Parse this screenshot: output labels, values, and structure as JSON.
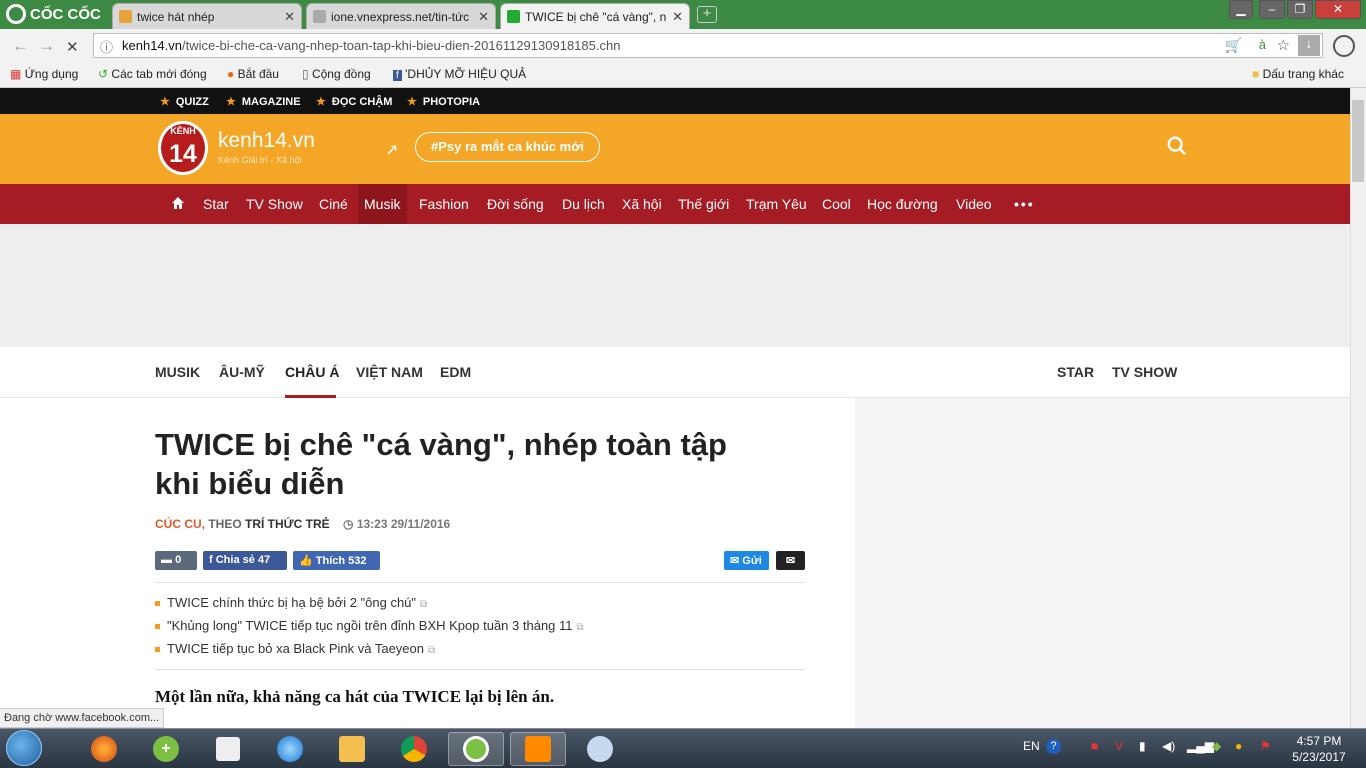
{
  "browser": {
    "logo": "CỐC CỐC",
    "tabs": [
      {
        "label": "twice hát nhép",
        "fav": "#e8a33c"
      },
      {
        "label": "ione.vnexpress.net/tin-tức",
        "fav": "#aaaaaa"
      },
      {
        "label": "TWICE bị chê \"cá vàng\", n",
        "fav": "#22aa33"
      }
    ],
    "url_domain": "kenh14.vn",
    "url_path": "/twice-bi-che-ca-vang-nhep-toan-tap-khi-bieu-dien-20161129130918185.chn"
  },
  "bookmarks": [
    "Ứng dụng",
    "Các tab mới đóng",
    "Bắt đầu",
    "Cộng đồng",
    "'DHỦY MỠ HIỆU QUẢ",
    "Dấu trang khác"
  ],
  "topstrip": [
    "QUIZZ",
    "MAGAZINE",
    "ĐỌC CHẬM",
    "PHOTOPIA"
  ],
  "header": {
    "badge_top": "KÊNH",
    "badge_num": "14",
    "site": "kenh14.vn",
    "tagline": "Kênh Giải trí - Xã hội",
    "trending": "#Psy ra mắt ca khúc mới"
  },
  "mainnav": [
    "Star",
    "TV Show",
    "Ciné",
    "Musik",
    "Fashion",
    "Đời sống",
    "Du lịch",
    "Xã hội",
    "Thế giới",
    "Trạm Yêu",
    "Cool",
    "Học đường",
    "Video"
  ],
  "subnav": {
    "left": [
      "MUSIK",
      "ÂU-MỸ",
      "CHÂU Á",
      "VIỆT NAM",
      "EDM"
    ],
    "right": [
      "STAR",
      "TV SHOW"
    ]
  },
  "article": {
    "title": "TWICE bị chê \"cá vàng\", nhép toàn tập khi biểu diễn",
    "author": "CÚC CU,",
    "theo": " THEO ",
    "source": "TRÍ THỨC TRẺ",
    "time": "13:23 29/11/2016",
    "comments": "0",
    "share": "Chia sẻ",
    "share_count": "47",
    "like": "Thích",
    "like_count": "532",
    "send": "Gửi",
    "related": [
      "TWICE chính thức bị hạ bệ bởi 2 \"ông chú\"",
      "\"Khủng long\" TWICE tiếp tục ngồi trên đỉnh BXH Kpop tuần 3 tháng 11",
      "TWICE tiếp tục bỏ xa Black Pink và Taeyeon"
    ],
    "lead": "Một lần nữa, khả năng ca hát của TWICE lại bị lên án."
  },
  "status": "Đang chờ www.facebook.com...",
  "taskbar": {
    "lang": "EN",
    "time": "4:57 PM",
    "date": "5/23/2017"
  },
  "colors": {
    "orange": "#f4a627",
    "red": "#a61c25",
    "green": "#3c8a43"
  }
}
